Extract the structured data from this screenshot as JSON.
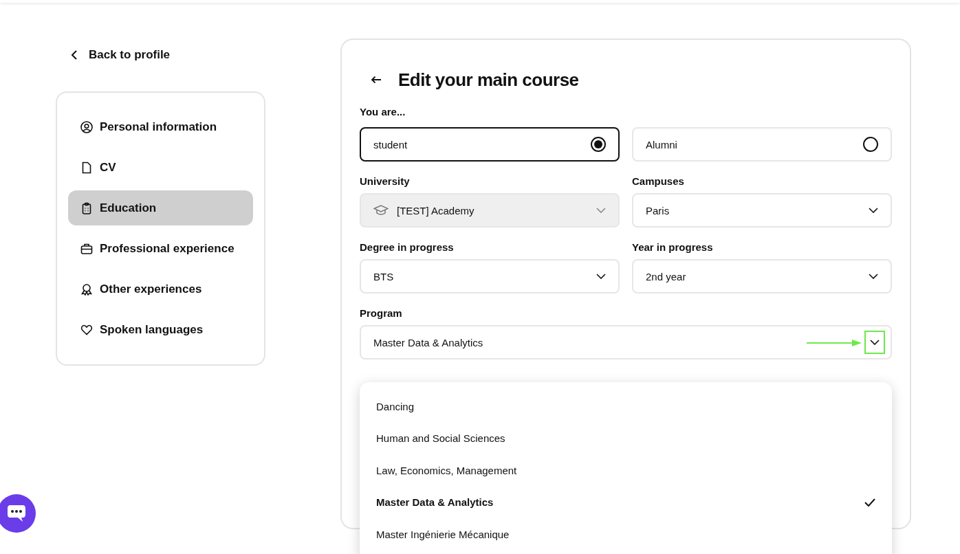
{
  "back_link": {
    "label": "Back to profile"
  },
  "sidebar": {
    "items": [
      {
        "label": "Personal information",
        "selected": false
      },
      {
        "label": "CV",
        "selected": false
      },
      {
        "label": "Education",
        "selected": true
      },
      {
        "label": "Professional experience",
        "selected": false
      },
      {
        "label": "Other experiences",
        "selected": false
      },
      {
        "label": "Spoken languages",
        "selected": false
      }
    ]
  },
  "form": {
    "title": "Edit your main course",
    "status_label": "You are...",
    "status_options": [
      {
        "label": "student",
        "selected": true
      },
      {
        "label": "Alumni",
        "selected": false
      }
    ],
    "fields": [
      {
        "label": "University",
        "value": "[TEST] Academy",
        "disabled": true
      },
      {
        "label": "Campuses",
        "value": "Paris",
        "disabled": false
      },
      {
        "label": "Degree in progress",
        "value": "BTS",
        "disabled": false
      },
      {
        "label": "Year in progress",
        "value": "2nd year",
        "disabled": false
      }
    ],
    "program": {
      "label": "Program",
      "value": "Master Data & Analytics",
      "expanded": true,
      "options": [
        {
          "label": "Dancing",
          "selected": false
        },
        {
          "label": "Human and Social Sciences",
          "selected": false
        },
        {
          "label": "Law, Economics, Management",
          "selected": false
        },
        {
          "label": "Master Data & Analytics",
          "selected": true
        },
        {
          "label": "Master Ingénierie Mécanique",
          "selected": false
        }
      ]
    }
  }
}
